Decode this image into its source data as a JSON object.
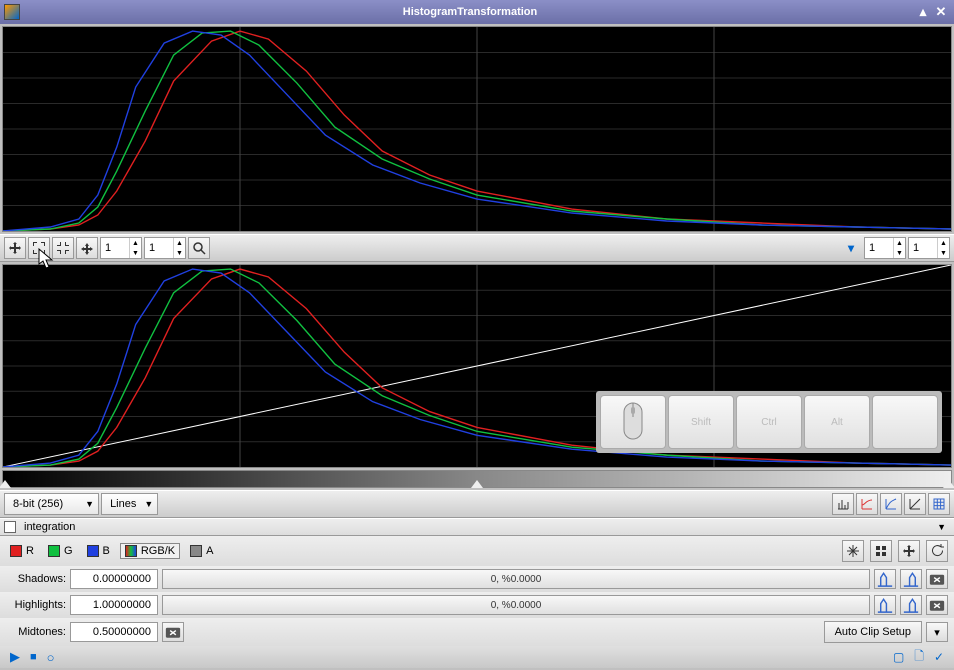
{
  "window": {
    "title": "HistogramTransformation"
  },
  "zoom_toolbar": {
    "spinner1": "1",
    "spinner2": "1",
    "spinner3": "1",
    "spinner4": "1"
  },
  "options": {
    "bit_depth": "8-bit (256)",
    "render_mode": "Lines"
  },
  "view": {
    "name": "integration"
  },
  "channels": {
    "r": "R",
    "g": "G",
    "b": "B",
    "rgbk": "RGB/K",
    "a": "A"
  },
  "params": {
    "shadows": {
      "label": "Shadows:",
      "value": "0.00000000",
      "readout": "0, %0.0000"
    },
    "highlights": {
      "label": "Highlights:",
      "value": "1.00000000",
      "readout": "0, %0.0000"
    },
    "midtones": {
      "label": "Midtones:",
      "value": "0.50000000"
    }
  },
  "buttons": {
    "auto_clip": "Auto Clip Setup"
  },
  "overlay_keys": {
    "shift": "Shift",
    "ctrl": "Ctrl",
    "alt": "Alt"
  },
  "chart_data": [
    {
      "type": "line",
      "title": "Input histogram",
      "xlim": [
        0,
        1
      ],
      "ylim": [
        0,
        1
      ],
      "series": [
        {
          "name": "R",
          "color": "#e02020",
          "x": [
            0.0,
            0.05,
            0.08,
            0.1,
            0.12,
            0.15,
            0.18,
            0.22,
            0.25,
            0.28,
            0.32,
            0.36,
            0.4,
            0.45,
            0.5,
            0.6,
            0.7,
            0.8,
            0.9,
            1.0
          ],
          "y": [
            0.0,
            0.01,
            0.03,
            0.08,
            0.2,
            0.45,
            0.75,
            0.95,
            1.0,
            0.96,
            0.8,
            0.58,
            0.4,
            0.28,
            0.2,
            0.11,
            0.06,
            0.04,
            0.02,
            0.01
          ]
        },
        {
          "name": "G",
          "color": "#10c040",
          "x": [
            0.0,
            0.05,
            0.08,
            0.1,
            0.12,
            0.15,
            0.18,
            0.21,
            0.24,
            0.27,
            0.31,
            0.35,
            0.4,
            0.45,
            0.5,
            0.6,
            0.7,
            0.8,
            0.9,
            1.0
          ],
          "y": [
            0.0,
            0.01,
            0.04,
            0.12,
            0.3,
            0.6,
            0.88,
            0.99,
            1.0,
            0.93,
            0.74,
            0.52,
            0.36,
            0.26,
            0.18,
            0.1,
            0.06,
            0.03,
            0.02,
            0.01
          ]
        },
        {
          "name": "B",
          "color": "#2040e0",
          "x": [
            0.0,
            0.05,
            0.08,
            0.1,
            0.12,
            0.14,
            0.17,
            0.2,
            0.23,
            0.26,
            0.3,
            0.34,
            0.39,
            0.44,
            0.5,
            0.6,
            0.7,
            0.8,
            0.9,
            1.0
          ],
          "y": [
            0.0,
            0.02,
            0.06,
            0.18,
            0.42,
            0.72,
            0.94,
            1.0,
            0.98,
            0.88,
            0.68,
            0.48,
            0.33,
            0.24,
            0.16,
            0.09,
            0.05,
            0.03,
            0.02,
            0.01
          ]
        }
      ]
    },
    {
      "type": "line",
      "title": "Output histogram + transfer",
      "xlim": [
        0,
        1
      ],
      "ylim": [
        0,
        1
      ],
      "transfer": {
        "x": [
          0,
          1
        ],
        "y": [
          0,
          1
        ],
        "color": "#ffffff"
      },
      "series": [
        {
          "name": "R",
          "color": "#e02020"
        },
        {
          "name": "G",
          "color": "#10c040"
        },
        {
          "name": "B",
          "color": "#2040e0"
        }
      ]
    }
  ]
}
